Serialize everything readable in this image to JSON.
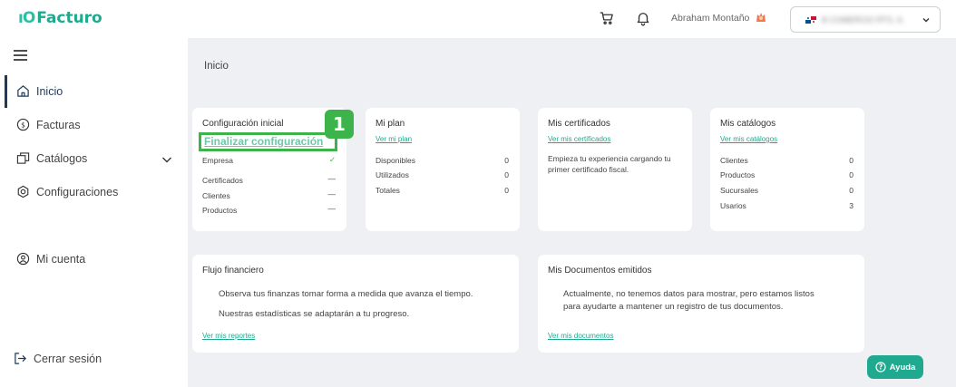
{
  "brand": {
    "logo_mark": "ıO",
    "name": "Facturo",
    "color": "#1fa98f"
  },
  "header": {
    "user_name": "Abraham Montaño",
    "company_name": "B COMERCIO RTS. A."
  },
  "sidebar": {
    "items": [
      {
        "label": "Inicio",
        "icon": "home-icon"
      },
      {
        "label": "Facturas",
        "icon": "dollar-circle-icon"
      },
      {
        "label": "Catálogos",
        "icon": "catalog-icon"
      },
      {
        "label": "Configuraciones",
        "icon": "gear-icon"
      },
      {
        "label": "Mi cuenta",
        "icon": "user-circle-icon"
      }
    ],
    "logout_label": "Cerrar sesión"
  },
  "main": {
    "page_title": "Inicio",
    "config_card": {
      "title": "Configuración inicial",
      "finalize_link": "Finalizar configuración",
      "step_badge": "1",
      "rows": [
        {
          "label": "Empresa",
          "status": "✓"
        },
        {
          "label": "Certificados",
          "status": "—"
        },
        {
          "label": "Clientes",
          "status": "—"
        },
        {
          "label": "Productos",
          "status": "—"
        }
      ]
    },
    "plan_card": {
      "title": "Mi plan",
      "link": "Ver mi plan",
      "rows": [
        {
          "label": "Disponibles",
          "value": "0"
        },
        {
          "label": "Utilizados",
          "value": "0"
        },
        {
          "label": "Totales",
          "value": "0"
        }
      ]
    },
    "certs_card": {
      "title": "Mis certificados",
      "link": "Ver mis certificados",
      "text_line1": "Empieza tu experiencia cargando tu",
      "text_line2": "primer certificado fiscal."
    },
    "catalogs_card": {
      "title": "Mis catálogos",
      "link": "Ver mis catálogos",
      "rows": [
        {
          "label": "Clientes",
          "value": "0"
        },
        {
          "label": "Productos",
          "value": "0"
        },
        {
          "label": "Sucursales",
          "value": "0"
        },
        {
          "label": "Usarios",
          "value": "3"
        }
      ]
    },
    "flow_card": {
      "title": "Flujo financiero",
      "text_line1": "Observa tus finanzas tomar forma a medida que avanza el tiempo.",
      "text_line2": "Nuestras estadísticas se adaptarán a tu progreso.",
      "link": "Ver mis reportes"
    },
    "docs_card": {
      "title": "Mis Documentos emitidos",
      "text_line1": "Actualmente, no tenemos datos para mostrar, pero estamos listos",
      "text_line2": "para ayudarte a mantener un registro de tus documentos.",
      "link": "Ver mis documentos"
    },
    "help_label": "Ayuda"
  }
}
